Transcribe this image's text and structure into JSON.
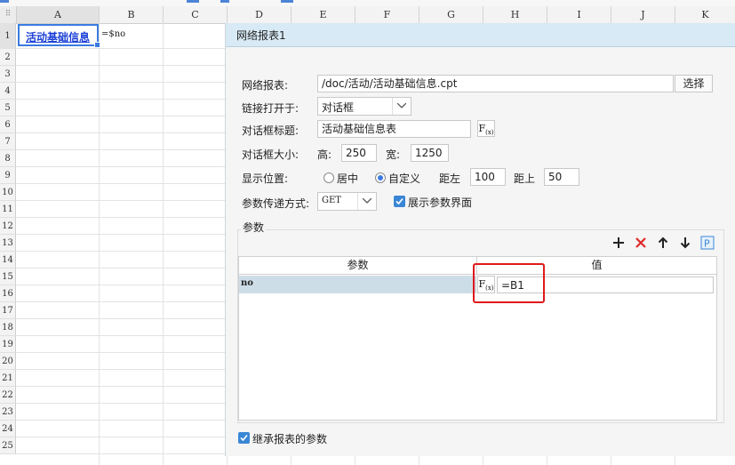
{
  "spreadsheet": {
    "columns": [
      "A",
      "B",
      "C",
      "D",
      "E",
      "F",
      "G",
      "H",
      "I",
      "J",
      "K"
    ],
    "rows": [
      "1",
      "2",
      "3",
      "4",
      "5",
      "6",
      "7",
      "8",
      "9",
      "10",
      "11",
      "12",
      "13",
      "14",
      "15",
      "16",
      "17",
      "18",
      "19",
      "20",
      "21",
      "22",
      "23",
      "24",
      "25"
    ],
    "cell_a1": "活动基础信息",
    "cell_b1": "=$no",
    "accent_color": "#3a7be0",
    "link_color": "#1a3fd6"
  },
  "dialog": {
    "title": "网络报表1",
    "network_report_label": "网络报表:",
    "network_report_path": "/doc/活动/活动基础信息.cpt",
    "choose_button": "选择",
    "open_link_label": "链接打开于:",
    "open_link_value": "对话框",
    "dialog_title_label": "对话框标题:",
    "dialog_title_value": "活动基础信息表",
    "fx_icon": "F(x)",
    "dialog_size_label": "对话框大小:",
    "height_label": "高:",
    "height_value": "250",
    "width_label": "宽:",
    "width_value": "1250",
    "position_label": "显示位置:",
    "position_center": "居中",
    "position_custom": "自定义",
    "left_label": "距左",
    "left_value": "100",
    "top_label": "距上",
    "top_value": "50",
    "param_method_label": "参数传递方式:",
    "param_method_value": "GET",
    "show_params_label": "展示参数界面",
    "params_group_label": "参数",
    "table": {
      "col_param": "参数",
      "col_value": "值",
      "rows": [
        {
          "param": "no",
          "value": "=B1"
        }
      ]
    },
    "toolbar_icons": [
      "plus-icon",
      "delete-icon",
      "arrow-up-icon",
      "arrow-down-icon",
      "p-icon"
    ],
    "inherit_params_label": "继承报表的参数",
    "highlight_color": "#e0191b"
  }
}
